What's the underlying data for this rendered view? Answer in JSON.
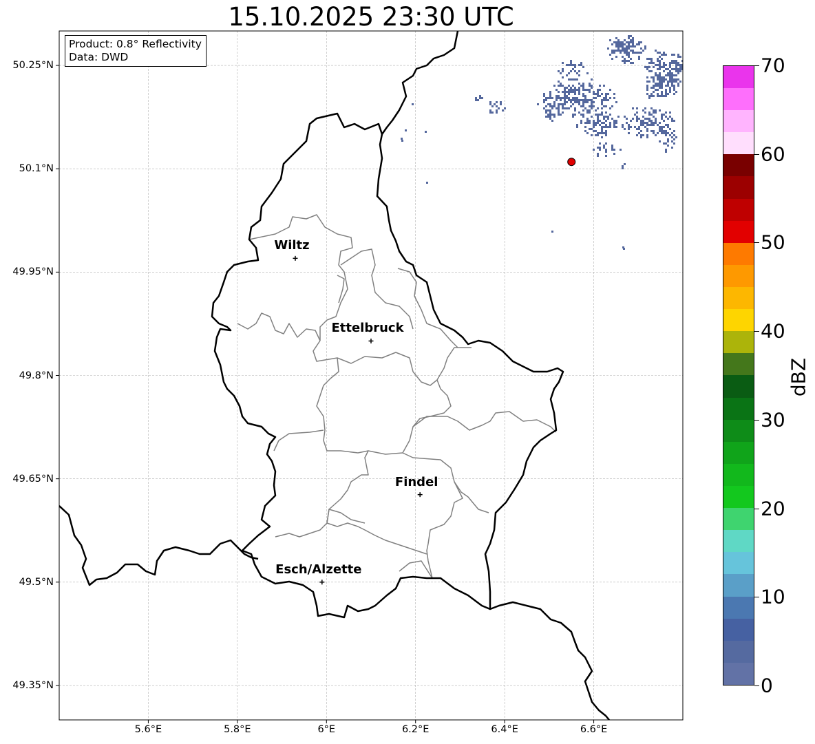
{
  "title": "15.10.2025 23:30 UTC",
  "info": {
    "product": "Product: 0.8° Reflectivity",
    "data_source": "Data: DWD"
  },
  "axes": {
    "lat_ticks": [
      "50.25°N",
      "50.1°N",
      "49.95°N",
      "49.8°N",
      "49.65°N",
      "49.5°N",
      "49.35°N"
    ],
    "lon_ticks": [
      "5.6°E",
      "5.8°E",
      "6°E",
      "6.2°E",
      "6.4°E",
      "6.6°E"
    ],
    "lat_range": [
      49.3,
      50.3
    ],
    "lon_range": [
      5.4,
      6.8
    ]
  },
  "stations": [
    {
      "name": "Wiltz",
      "lat": 49.97,
      "lon": 5.93
    },
    {
      "name": "Ettelbruck",
      "lat": 49.85,
      "lon": 6.1
    },
    {
      "name": "Findel",
      "lat": 49.627,
      "lon": 6.21
    },
    {
      "name": "Esch/Alzette",
      "lat": 49.5,
      "lon": 5.99
    }
  ],
  "marker": {
    "lat": 50.11,
    "lon": 6.55,
    "color": "#e00000"
  },
  "colorbar": {
    "label": "dBZ",
    "ticks": [
      "0",
      "10",
      "20",
      "30",
      "40",
      "50",
      "60",
      "70"
    ],
    "range": [
      0,
      70
    ],
    "colors": [
      "#6272a6",
      "#556aa0",
      "#4661a2",
      "#4b78b1",
      "#5a9fc8",
      "#66c4db",
      "#5fd8c5",
      "#3fd46f",
      "#13c81e",
      "#12b81c",
      "#10a41a",
      "#0e8c18",
      "#0a7415",
      "#0a5c13",
      "#44771b",
      "#acb40a",
      "#fed500",
      "#fdb700",
      "#fe9900",
      "#fe7a00",
      "#e20000",
      "#bf0000",
      "#9c0000",
      "#790000",
      "#ffdefd",
      "#ffb4fe",
      "#fe6ffc",
      "#ea34ec"
    ]
  },
  "radar_echo_color": "#55689d"
}
